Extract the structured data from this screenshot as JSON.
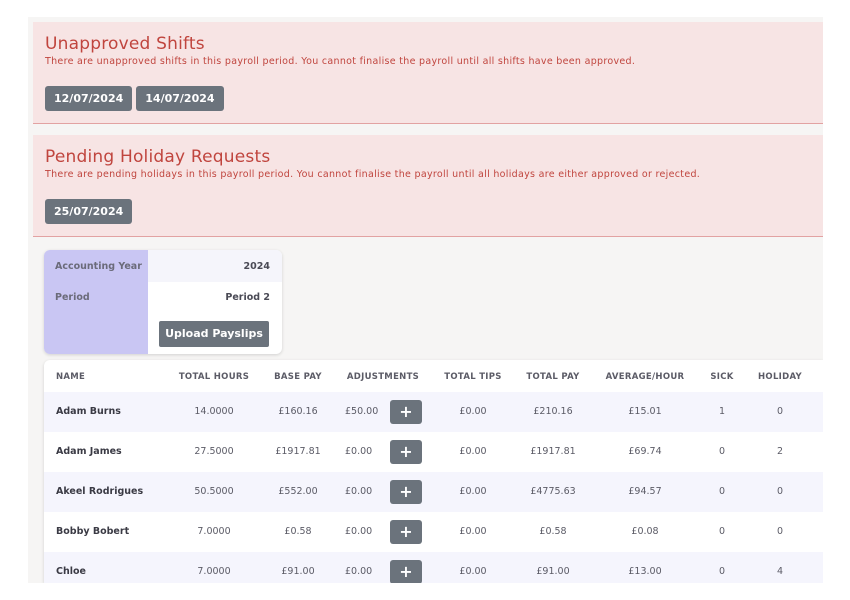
{
  "alerts": {
    "unapproved": {
      "title": "Unapproved Shifts",
      "message": "There are unapproved shifts in this payroll period. You cannot finalise the payroll until all shifts have been approved.",
      "dates": [
        "12/07/2024",
        "14/07/2024"
      ]
    },
    "holiday": {
      "title": "Pending Holiday Requests",
      "message": "There are pending holidays in this payroll period. You cannot finalise the payroll until all holidays are either approved or rejected.",
      "dates": [
        "25/07/2024"
      ]
    }
  },
  "info": {
    "accounting_year_label": "Accounting Year",
    "accounting_year_value": "2024",
    "period_label": "Period",
    "period_value": "Period 2",
    "upload_label": "Upload Payslips"
  },
  "table": {
    "headers": [
      "NAME",
      "TOTAL HOURS",
      "BASE PAY",
      "ADJUSTMENTS",
      "TOTAL TIPS",
      "TOTAL PAY",
      "AVERAGE/HOUR",
      "SICK",
      "HOLIDAY"
    ],
    "plus_label": "+",
    "rows": [
      {
        "name": "Adam Burns",
        "hours": "14.0000",
        "base": "£160.16",
        "adj": "£50.00",
        "tips": "£0.00",
        "total": "£210.16",
        "avg": "£15.01",
        "sick": "1",
        "holiday": "0"
      },
      {
        "name": "Adam James",
        "hours": "27.5000",
        "base": "£1917.81",
        "adj": "£0.00",
        "tips": "£0.00",
        "total": "£1917.81",
        "avg": "£69.74",
        "sick": "0",
        "holiday": "2"
      },
      {
        "name": "Akeel Rodrigues",
        "hours": "50.5000",
        "base": "£552.00",
        "adj": "£0.00",
        "tips": "£0.00",
        "total": "£4775.63",
        "avg": "£94.57",
        "sick": "0",
        "holiday": "0"
      },
      {
        "name": "Bobby Bobert",
        "hours": "7.0000",
        "base": "£0.58",
        "adj": "£0.00",
        "tips": "£0.00",
        "total": "£0.58",
        "avg": "£0.08",
        "sick": "0",
        "holiday": "0"
      },
      {
        "name": "Chloe",
        "hours": "7.0000",
        "base": "£91.00",
        "adj": "£0.00",
        "tips": "£0.00",
        "total": "£91.00",
        "avg": "£13.00",
        "sick": "0",
        "holiday": "4"
      }
    ]
  }
}
